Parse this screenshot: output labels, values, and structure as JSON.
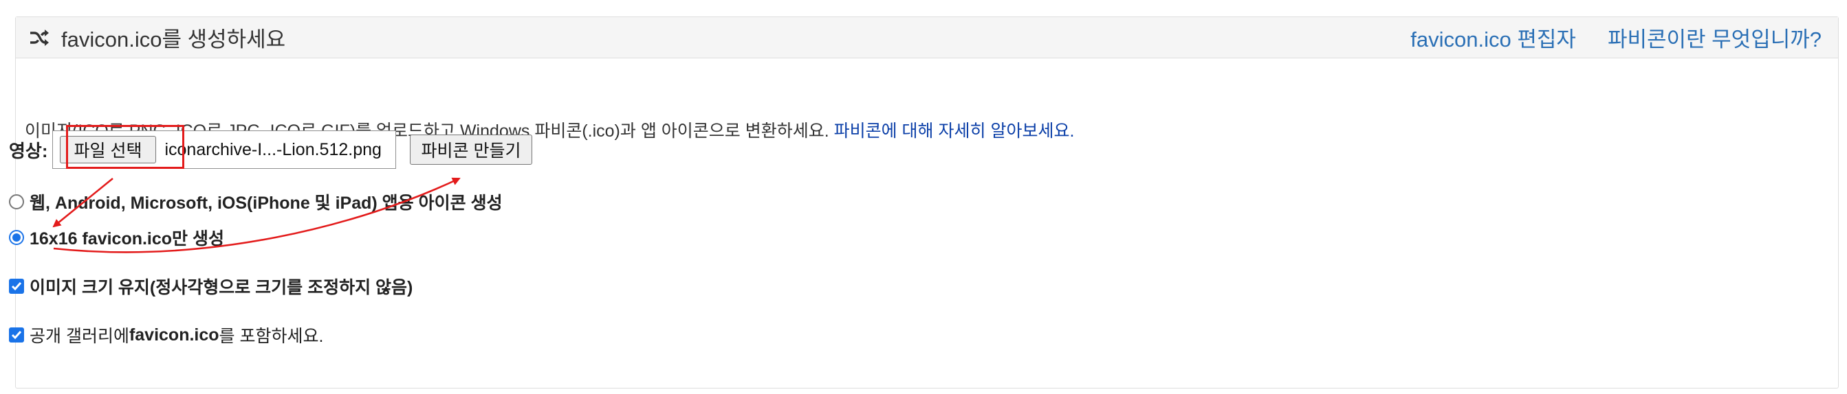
{
  "header": {
    "title": "favicon.ico를 생성하세요",
    "links": [
      "favicon.ico 편집자",
      "파비콘이란 무엇입니까?"
    ]
  },
  "intro": {
    "text": "이미지(ICO로 PNG, ICO로 JPG, ICO로 GIF)를 업로드하고 Windows 파비콘(.ico)과 앱 아이콘으로 변환하세요. ",
    "link": "파비콘에 대해 자세히 알아보세요."
  },
  "upload": {
    "label": "영상:",
    "choose_button": "파일 선택",
    "file_name": "iconarchive-I...-Lion.512.png",
    "create_button": "파비콘 만들기"
  },
  "options": {
    "radio_all": {
      "label": "웹, Android, Microsoft, iOS(iPhone 및 iPad) 앱용 아이콘 생성",
      "selected": false
    },
    "radio_16": {
      "label": "16x16 favicon.ico만 생성",
      "selected": true
    },
    "keep_size": {
      "label": "이미지 크기 유지(정사각형으로 크기를 조정하지 않음)",
      "checked": true
    },
    "gallery": {
      "label_prefix": "공개 갤러리에 ",
      "label_bold": "favicon.ico",
      "label_suffix": "를 포함하세요.",
      "checked": true
    }
  },
  "colors": {
    "accent": "#1a73e8",
    "link": "#2a6fb5",
    "annotation": "#e31b1b"
  },
  "icons": {
    "header": "shuffle-icon",
    "check": "checkmark-icon"
  }
}
